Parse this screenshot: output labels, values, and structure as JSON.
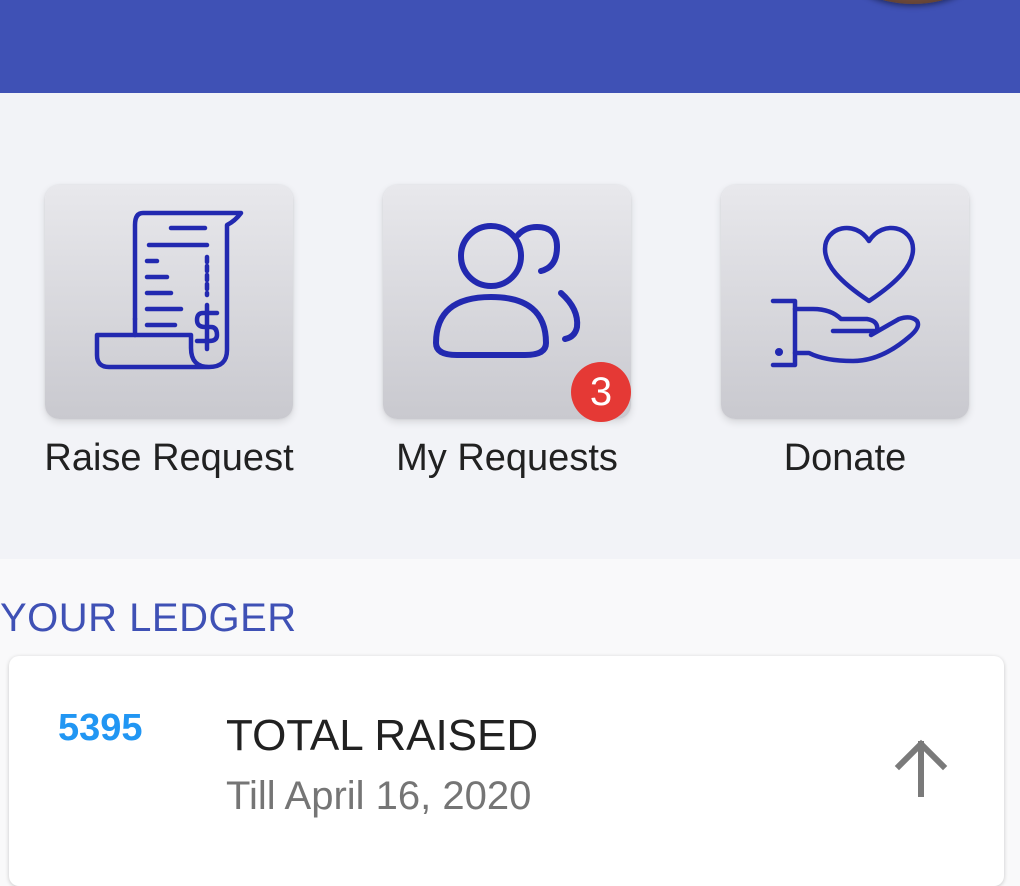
{
  "colors": {
    "app_bar": "#3f51b5",
    "icon_stroke": "#2229b0",
    "badge": "#e53935",
    "amount": "#2196f3",
    "section_title": "#3f51b5"
  },
  "header": {
    "avatar_icon": "profile-avatar"
  },
  "actions": [
    {
      "label": "Raise Request",
      "icon": "receipt-dollar-icon"
    },
    {
      "label": "My Requests",
      "icon": "users-icon",
      "badge": "3"
    },
    {
      "label": "Donate",
      "icon": "heart-hand-icon"
    }
  ],
  "ledger": {
    "title": "YOUR LEDGER",
    "card": {
      "amount": "5395",
      "title": "TOTAL RAISED",
      "subtitle": "Till April 16, 2020",
      "trend_icon": "arrow-up-icon"
    }
  }
}
